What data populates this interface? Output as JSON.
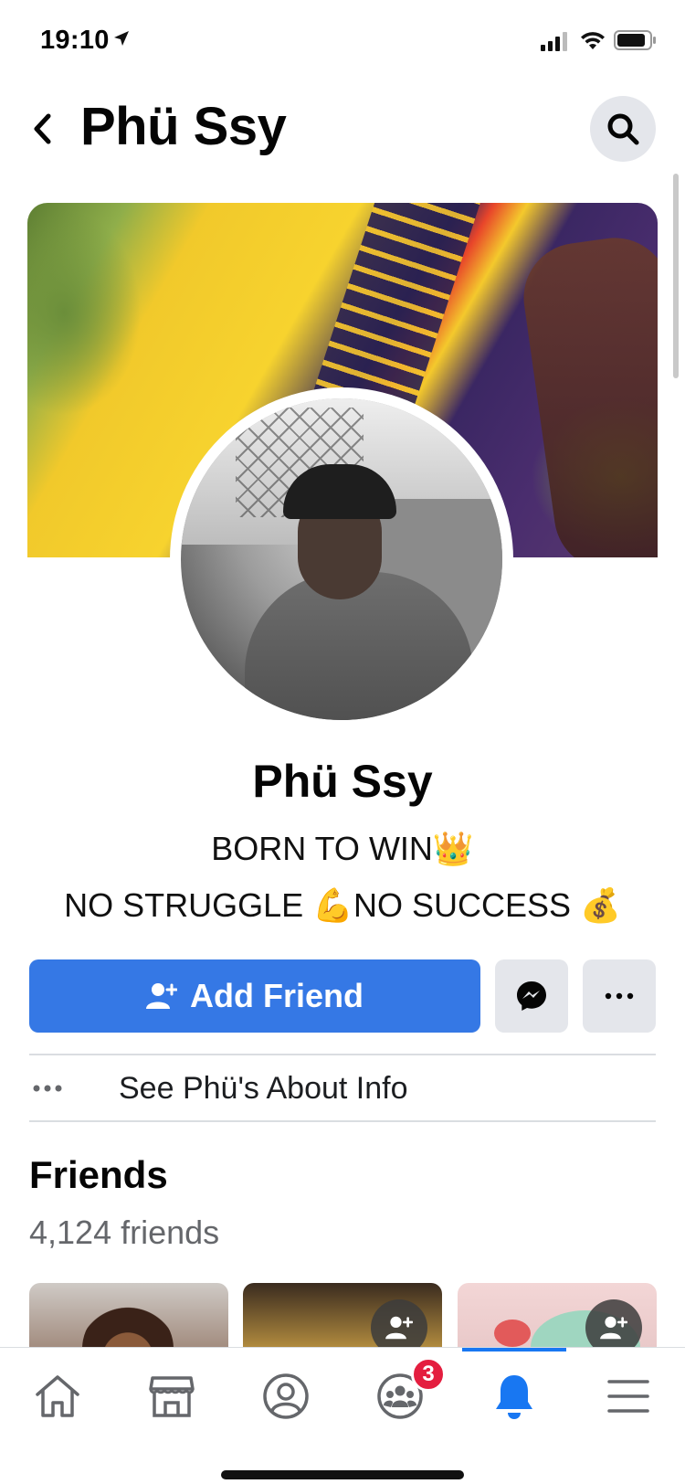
{
  "status_bar": {
    "time": "19:10",
    "icons": [
      "location-arrow-icon",
      "cellular-signal-icon",
      "wifi-icon",
      "battery-icon"
    ]
  },
  "header": {
    "title": "Phü Ssy",
    "back_icon": "chevron-left-icon",
    "search_icon": "search-icon"
  },
  "profile": {
    "name": "Phü Ssy",
    "bio_line_1": "BORN TO WIN👑",
    "bio_line_2": "NO STRUGGLE 💪NO SUCCESS 💰"
  },
  "actions": {
    "add_friend_label": "Add Friend",
    "messenger_icon": "messenger-icon",
    "more_icon": "more-horizontal-icon"
  },
  "about": {
    "label": "See Phü's About Info"
  },
  "friends": {
    "title": "Friends",
    "count": "4,124 friends"
  },
  "tabbar": {
    "tabs": [
      {
        "name": "home",
        "icon": "home-icon"
      },
      {
        "name": "marketplace",
        "icon": "marketplace-icon"
      },
      {
        "name": "profile",
        "icon": "profile-icon"
      },
      {
        "name": "groups",
        "icon": "groups-icon",
        "badge": "3"
      },
      {
        "name": "notifications",
        "icon": "bell-icon",
        "active": true
      },
      {
        "name": "menu",
        "icon": "menu-icon"
      }
    ],
    "groups_badge": "3"
  },
  "colors": {
    "accent": "#1877f2",
    "button_primary": "#3578e5",
    "button_secondary": "#e4e6eb",
    "badge": "#e41e3f",
    "muted_text": "#65676b"
  }
}
